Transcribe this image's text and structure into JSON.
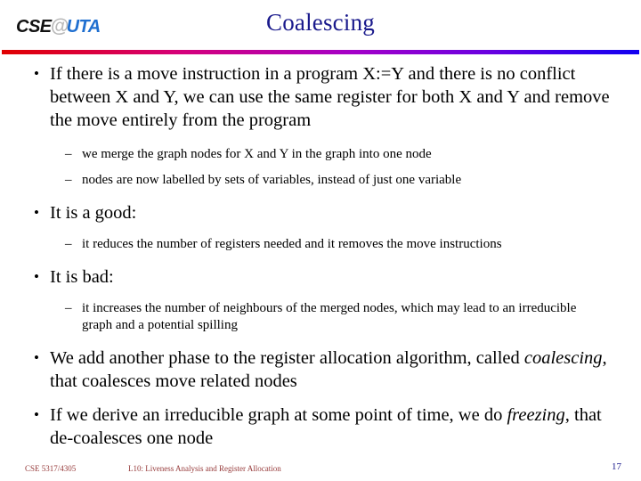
{
  "header": {
    "logo": {
      "part1": "CSE",
      "at_symbol": "@",
      "part2": "UTA"
    },
    "title": "Coalescing",
    "rule_color_start": "#e00000",
    "rule_color_end": "#1000f0",
    "title_color": "#1a1a8c"
  },
  "body": {
    "b1": {
      "bullet": "•",
      "text": "If there is a move instruction in a program X:=Y and there is no conflict between X and Y, we can use the same register for both X and Y and remove the move entirely from the program"
    },
    "b1s1": {
      "bullet": "–",
      "text": "we merge the graph nodes for X and Y in the graph into one node"
    },
    "b1s2": {
      "bullet": "–",
      "text": "nodes are now labelled by sets of variables, instead of just one variable"
    },
    "b2": {
      "bullet": "•",
      "text": "It is a good:"
    },
    "b2s1": {
      "bullet": "–",
      "text": "it reduces the number of registers needed and it removes the move instructions"
    },
    "b3": {
      "bullet": "•",
      "text": "It is bad:"
    },
    "b3s1": {
      "bullet": "–",
      "text": "it increases the number of neighbours of the merged nodes, which may lead to an irreducible graph and a potential spilling"
    },
    "b4": {
      "bullet": "•",
      "text_before": "We add another phase to the register allocation algorithm, called ",
      "emphasis": "coalescing",
      "text_after": ", that coalesces move related nodes"
    },
    "b5": {
      "bullet": "•",
      "text_before": "If we derive an irreducible graph at some point of time, we do ",
      "emphasis": "freezing",
      "text_after": ", that de-coalesces one node"
    }
  },
  "footer": {
    "course": "CSE 5317/4305",
    "lecture": "L10: Liveness Analysis and Register Allocation",
    "page_number": "17",
    "text_color": "#963a3a"
  }
}
